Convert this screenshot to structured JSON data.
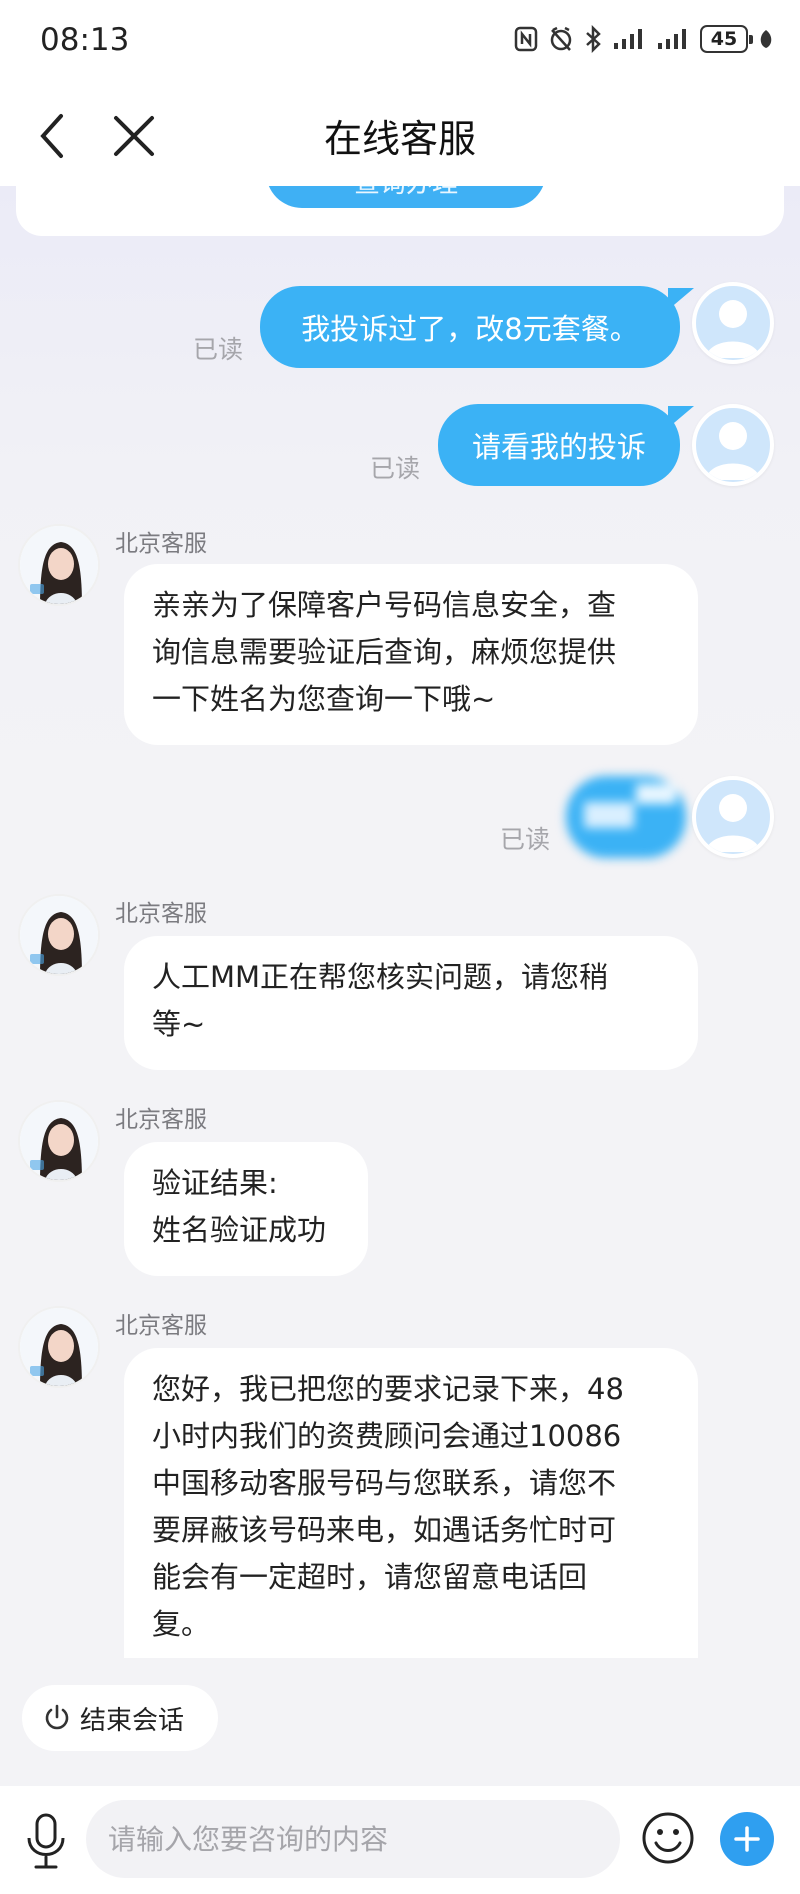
{
  "status_bar": {
    "time": "08:13",
    "battery": "45"
  },
  "nav": {
    "title": "在线客服"
  },
  "prev_card": {
    "button_label": "查询办理"
  },
  "messages": [
    {
      "from": "user",
      "text": "我投诉过了，改8元套餐。",
      "read": "已读"
    },
    {
      "from": "user",
      "text": "请看我的投诉",
      "read": "已读"
    },
    {
      "from": "agent",
      "name": "北京客服",
      "text": "亲亲为了保障客户号码信息安全，查\n询信息需要验证后查询，麻烦您提供\n一下姓名为您查询一下哦~"
    },
    {
      "from": "user",
      "text": "",
      "read": "已读"
    },
    {
      "from": "agent",
      "name": "北京客服",
      "text": "人工MM正在帮您核实问题，请您稍\n等~"
    },
    {
      "from": "agent",
      "name": "北京客服",
      "text": "验证结果:\n姓名验证成功"
    },
    {
      "from": "agent",
      "name": "北京客服",
      "text": "您好，我已把您的要求记录下来，48\n小时内我们的资费顾问会通过10086\n中国移动客服号码与您联系，请您不\n要屏蔽该号码来电，如遇话务忙时可\n能会有一定超时，请您留意电话回\n复。"
    }
  ],
  "end_session": {
    "label": "结束会话"
  },
  "input": {
    "placeholder": "请输入您要咨询的内容"
  },
  "colors": {
    "accent": "#3bb2f5",
    "send_button": "#2f9ff0",
    "read_text": "#a6a6ab"
  }
}
